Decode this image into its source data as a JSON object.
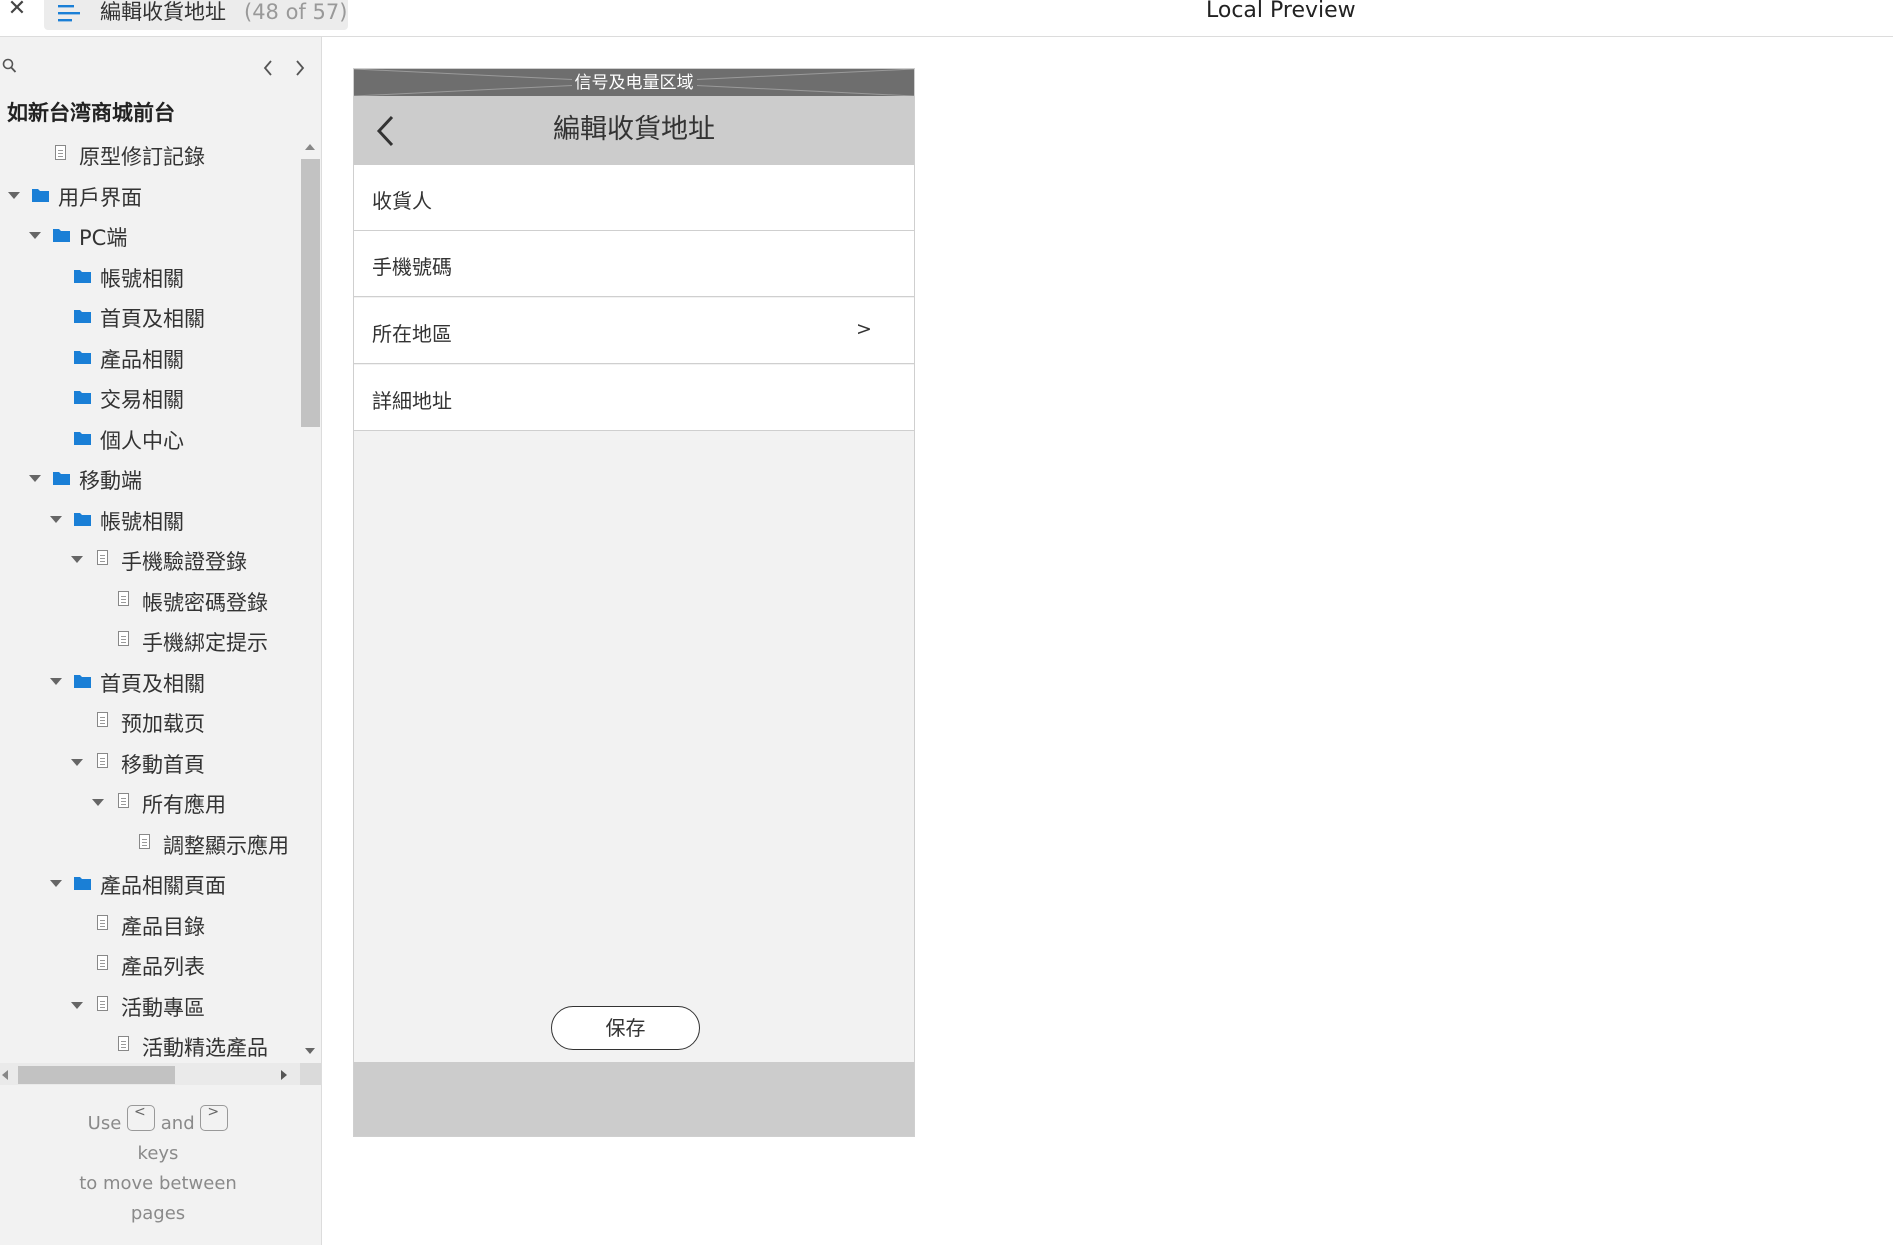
{
  "header": {
    "page_title": "編輯收貨地址",
    "page_count": "(48 of 57)",
    "preview_title": "Local Preview"
  },
  "sidebar": {
    "project_title": "如新台湾商城前台",
    "tree": [
      {
        "label": "原型修訂記錄",
        "type": "page",
        "depth": 1,
        "expanded": null
      },
      {
        "label": "用戶界面",
        "type": "folder",
        "depth": 0,
        "expanded": true
      },
      {
        "label": "PC端",
        "type": "folder",
        "depth": 1,
        "expanded": true
      },
      {
        "label": "帳號相關",
        "type": "folder",
        "depth": 2,
        "expanded": null
      },
      {
        "label": "首頁及相關",
        "type": "folder",
        "depth": 2,
        "expanded": null
      },
      {
        "label": "產品相關",
        "type": "folder",
        "depth": 2,
        "expanded": null
      },
      {
        "label": "交易相關",
        "type": "folder",
        "depth": 2,
        "expanded": null
      },
      {
        "label": "個人中心",
        "type": "folder",
        "depth": 2,
        "expanded": null
      },
      {
        "label": "移動端",
        "type": "folder",
        "depth": 1,
        "expanded": true
      },
      {
        "label": "帳號相關",
        "type": "folder",
        "depth": 2,
        "expanded": true
      },
      {
        "label": "手機驗證登錄",
        "type": "page",
        "depth": 3,
        "expanded": true
      },
      {
        "label": "帳號密碼登錄",
        "type": "page",
        "depth": 4,
        "expanded": null
      },
      {
        "label": "手機綁定提示",
        "type": "page",
        "depth": 4,
        "expanded": null
      },
      {
        "label": "首頁及相關",
        "type": "folder",
        "depth": 2,
        "expanded": true
      },
      {
        "label": "预加载页",
        "type": "page",
        "depth": 3,
        "expanded": null
      },
      {
        "label": "移動首頁",
        "type": "page",
        "depth": 3,
        "expanded": true
      },
      {
        "label": "所有應用",
        "type": "page",
        "depth": 4,
        "expanded": true
      },
      {
        "label": "調整顯示應用",
        "type": "page",
        "depth": 5,
        "expanded": null
      },
      {
        "label": "產品相關頁面",
        "type": "folder",
        "depth": 2,
        "expanded": true
      },
      {
        "label": "產品目錄",
        "type": "page",
        "depth": 3,
        "expanded": null
      },
      {
        "label": "產品列表",
        "type": "page",
        "depth": 3,
        "expanded": null
      },
      {
        "label": "活動專區",
        "type": "page",
        "depth": 3,
        "expanded": true
      },
      {
        "label": "活動精选產品",
        "type": "page",
        "depth": 4,
        "expanded": null
      }
    ],
    "help": {
      "use": "Use",
      "key_prev": "<",
      "and": "and",
      "key_next": ">",
      "line2": "keys",
      "line3": "to move between",
      "line4": "pages"
    }
  },
  "phone": {
    "status_bar_label": "信号及电量区域",
    "nav_title": "編輯收貨地址",
    "fields": [
      {
        "label": "收貨人",
        "chevron": ""
      },
      {
        "label": "手機號碼",
        "chevron": ""
      },
      {
        "label": "所在地區",
        "chevron": ">"
      },
      {
        "label": "詳細地址",
        "chevron": ""
      }
    ],
    "save_label": "保存"
  },
  "colors": {
    "folder_blue": "#1a7fd6",
    "status_bar": "#6e6e6e",
    "nav_bar": "#cccccc",
    "phone_bg": "#f2f2f2"
  },
  "icons": {
    "close": "close-icon",
    "menu": "menu-icon",
    "search": "search-icon",
    "prev": "chevron-left-icon",
    "next": "chevron-right-icon",
    "back": "back-arrow-icon",
    "folder": "folder-icon",
    "page": "page-icon"
  }
}
